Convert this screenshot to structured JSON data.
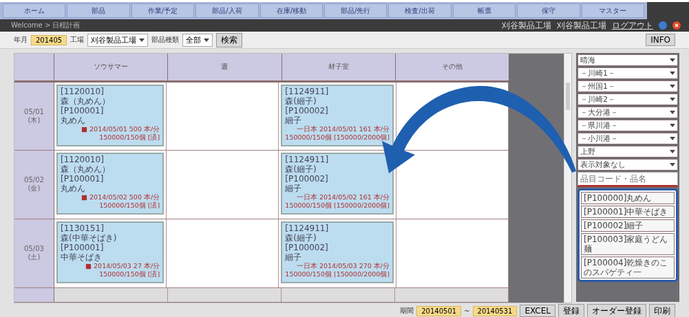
{
  "nav_tabs": [
    {
      "label": "ホーム"
    },
    {
      "label": "部品"
    },
    {
      "label": "作業/予定"
    },
    {
      "label": "部品/入荷"
    },
    {
      "label": "在庫/移動"
    },
    {
      "label": "部品/先行"
    },
    {
      "label": "検査/出荷"
    },
    {
      "label": "帳票"
    },
    {
      "label": "保守"
    },
    {
      "label": "マスター"
    }
  ],
  "breadcrumb": "Welcome > 日程計画",
  "user_links": [
    "刈谷製品工場",
    "刈谷製品工場",
    "ログアウト"
  ],
  "toolbar": {
    "month_label": "年月",
    "month_value": "201405",
    "factory_label": "工場",
    "factory_value": "刈谷製品工場",
    "type_label": "部品種類",
    "type_value": "全部",
    "search_button": "検索",
    "info_button": "INFO"
  },
  "grid": {
    "columns": [
      "ソウサマー",
      "週",
      "材子室",
      "その他"
    ],
    "rows": [
      {
        "date": "05/01",
        "weekday": "(木)",
        "cells": [
          {
            "kind": "order",
            "lines": [
              "[1120010]",
              "森（丸めん）",
              "[P100001]",
              "丸めん"
            ],
            "detail": "■ 2014/05/01 500 本/分",
            "status": "150000/150個 [済]"
          },
          {
            "kind": "empty"
          },
          {
            "kind": "order",
            "lines": [
              "[1124911]",
              "森(細子)",
              "[P100002]",
              "細子"
            ],
            "detail": "一日本 2014/05/01 161 本/分",
            "status": "150000/150個 [150000/2000個]"
          },
          {
            "kind": "empty"
          }
        ]
      },
      {
        "date": "05/02",
        "weekday": "(金)",
        "cells": [
          {
            "kind": "order",
            "lines": [
              "[1120010]",
              "森（丸めん）",
              "[P100001]",
              "丸めん"
            ],
            "detail": "■ 2014/05/02 500 本/分",
            "status": "150000/150個 [済]"
          },
          {
            "kind": "empty"
          },
          {
            "kind": "order",
            "lines": [
              "[1124911]",
              "森(細子)",
              "[P100002]",
              "細子"
            ],
            "detail": "一日本 2014/05/02 161 本/分",
            "status": "150000/150個 [150000/2000個]"
          },
          {
            "kind": "empty"
          }
        ]
      },
      {
        "date": "05/03",
        "weekday": "(土)",
        "cells": [
          {
            "kind": "order",
            "lines": [
              "[1130151]",
              "森(中華そばき)",
              "[P100001]",
              "中華そばき"
            ],
            "detail": "■ 2014/05/03 27 本/分",
            "status": "150000/150個 [済]"
          },
          {
            "kind": "empty"
          },
          {
            "kind": "order",
            "lines": [
              "[1124911]",
              "森(細子)",
              "[P100002]",
              "細子"
            ],
            "detail": "一日本 2014/05/03 270 本/分",
            "status": "150000/150個 [150000/2000個]"
          },
          {
            "kind": "empty"
          }
        ]
      }
    ]
  },
  "side_panel": {
    "selects": [
      "晴海",
      "－川崎1－",
      "－州国1－",
      "－川崎2－",
      "－大分港－",
      "－県川港－",
      "－小川港－",
      "上野",
      "表示対象なし"
    ],
    "search_placeholder": "品目コード・品名",
    "items": [
      "[P100000]丸めん",
      "[P100001]中華そばき",
      "[P100002]細子",
      "[P100003]家庭うどん麺",
      "[P100004]乾燥きのこのスパゲティ一"
    ]
  },
  "footer": {
    "period_label": "期間",
    "from": "20140501",
    "separator": "~",
    "to": "20140531",
    "buttons": [
      "EXCEL",
      "登録",
      "オーダー登録",
      "印刷"
    ]
  }
}
